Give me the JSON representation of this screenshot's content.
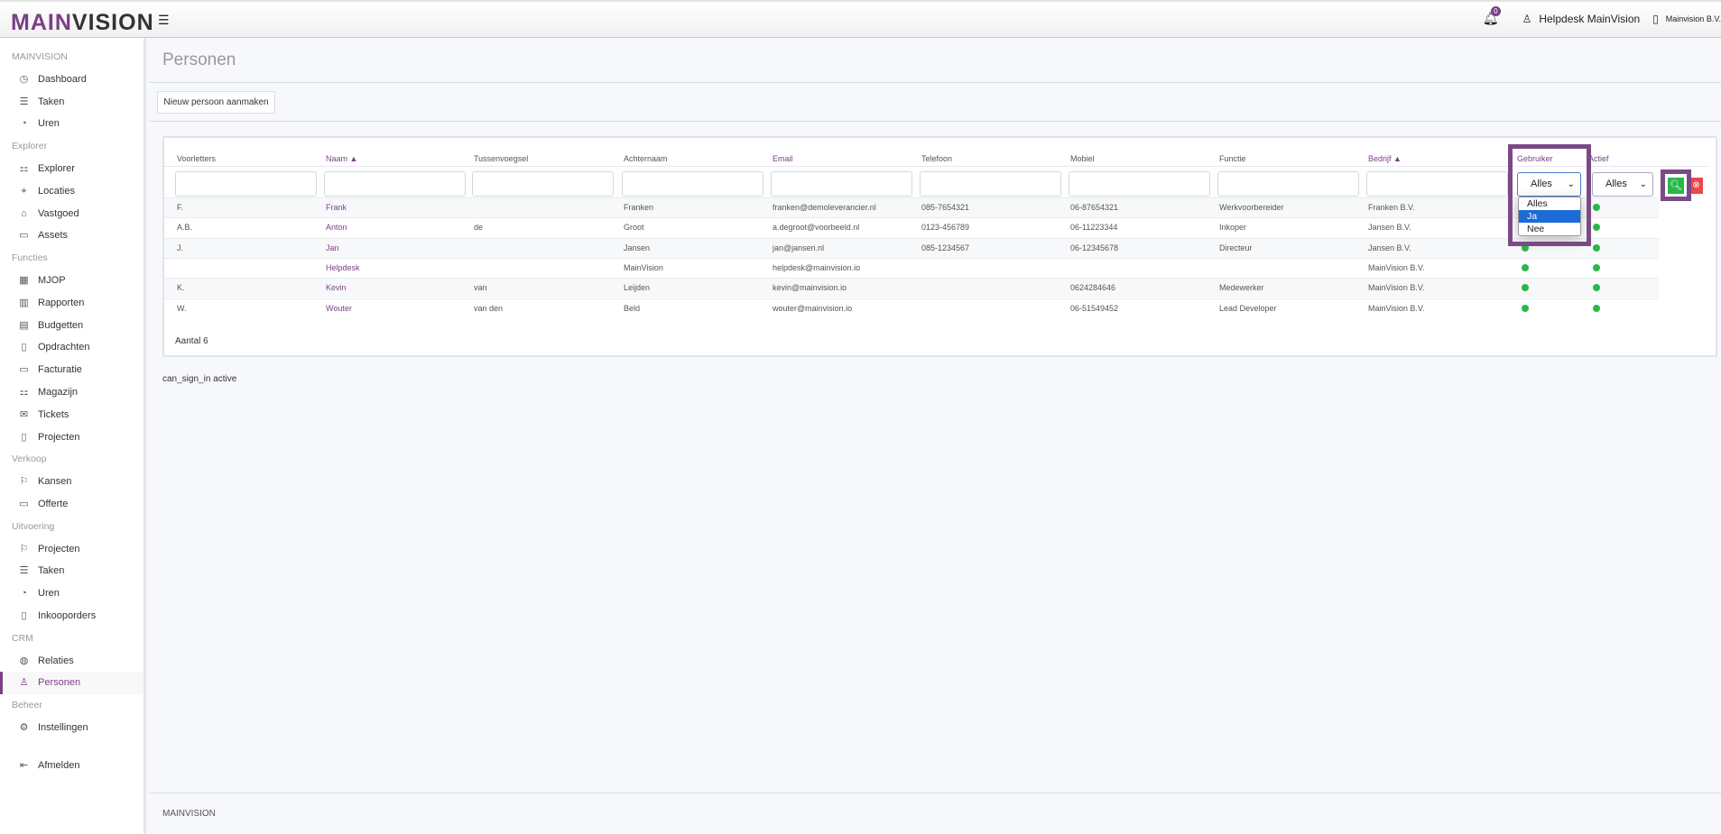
{
  "header": {
    "logo_a": "MAIN",
    "logo_b": "VISION",
    "notifications": "0",
    "user": "Helpdesk MainVision",
    "company": "Mainvision B.V."
  },
  "sidebar": [
    {
      "type": "section",
      "label": "MAINVISION"
    },
    {
      "type": "item",
      "label": "Dashboard",
      "icon": "◷"
    },
    {
      "type": "item",
      "label": "Taken",
      "icon": "☰"
    },
    {
      "type": "item",
      "label": "Uren",
      "icon": "◔"
    },
    {
      "type": "section",
      "label": "Explorer"
    },
    {
      "type": "item",
      "label": "Explorer",
      "icon": "⚏"
    },
    {
      "type": "item",
      "label": "Locaties",
      "icon": "⌖"
    },
    {
      "type": "item",
      "label": "Vastgoed",
      "icon": "⌂"
    },
    {
      "type": "item",
      "label": "Assets",
      "icon": "▭"
    },
    {
      "type": "section",
      "label": "Functies"
    },
    {
      "type": "item",
      "label": "MJOP",
      "icon": "▦"
    },
    {
      "type": "item",
      "label": "Rapporten",
      "icon": "▥"
    },
    {
      "type": "item",
      "label": "Budgetten",
      "icon": "▤"
    },
    {
      "type": "item",
      "label": "Opdrachten",
      "icon": "▯"
    },
    {
      "type": "item",
      "label": "Facturatie",
      "icon": "▭"
    },
    {
      "type": "item",
      "label": "Magazijn",
      "icon": "⚏"
    },
    {
      "type": "item",
      "label": "Tickets",
      "icon": "✉"
    },
    {
      "type": "item",
      "label": "Projecten",
      "icon": "▯"
    },
    {
      "type": "section",
      "label": "Verkoop"
    },
    {
      "type": "item",
      "label": "Kansen",
      "icon": "⚐"
    },
    {
      "type": "item",
      "label": "Offerte",
      "icon": "▭"
    },
    {
      "type": "section",
      "label": "Uitvoering"
    },
    {
      "type": "item",
      "label": "Projecten",
      "icon": "⚐"
    },
    {
      "type": "item",
      "label": "Taken",
      "icon": "☰"
    },
    {
      "type": "item",
      "label": "Uren",
      "icon": "◔"
    },
    {
      "type": "item",
      "label": "Inkooporders",
      "icon": "▯"
    },
    {
      "type": "section",
      "label": "CRM"
    },
    {
      "type": "item",
      "label": "Relaties",
      "icon": "◍"
    },
    {
      "type": "item",
      "label": "Personen",
      "icon": "♙",
      "active": true
    },
    {
      "type": "section",
      "label": "Beheer"
    },
    {
      "type": "item",
      "label": "Instellingen",
      "icon": "⚙"
    },
    {
      "type": "gap"
    },
    {
      "type": "item",
      "label": "Afmelden",
      "icon": "⇤"
    }
  ],
  "page": {
    "title": "Personen",
    "new_button": "Nieuw persoon aanmaken",
    "count": "Aantal 6",
    "note": "can_sign_in active",
    "footer": "MAINVISION"
  },
  "table": {
    "columns": [
      {
        "label": "Voorletters",
        "sorted": false
      },
      {
        "label": "Naam ▲",
        "sorted": true
      },
      {
        "label": "Tussenvoegsel",
        "sorted": false
      },
      {
        "label": "Achternaam",
        "sorted": false
      },
      {
        "label": "Email",
        "sorted": true
      },
      {
        "label": "Telefoon",
        "sorted": false
      },
      {
        "label": "Mobiel",
        "sorted": false
      },
      {
        "label": "Functie",
        "sorted": false
      },
      {
        "label": "Bedrijf ▲",
        "sorted": true
      },
      {
        "label": "Gebruiker",
        "sorted": true
      },
      {
        "label": "Actief",
        "sorted": true
      }
    ],
    "filters": {
      "gebruiker": "Alles",
      "actief": "Alles",
      "gebruiker_options": [
        "Alles",
        "Ja",
        "Nee"
      ],
      "highlighted_option": "Ja"
    },
    "rows": [
      [
        "F.",
        "Frank",
        "",
        "Franken",
        "franken@demoleverancier.nl",
        "085-7654321",
        "06-87654321",
        "Werkvoorbereider",
        "Franken B.V.",
        true,
        true
      ],
      [
        "A.B.",
        "Anton",
        "de",
        "Groot",
        "a.degroot@voorbeeld.nl",
        "0123-456789",
        "06-11223344",
        "Inkoper",
        "Jansen B.V.",
        true,
        true
      ],
      [
        "J.",
        "Jan",
        "",
        "Jansen",
        "jan@jansen.nl",
        "085-1234567",
        "06-12345678",
        "Directeur",
        "Jansen B.V.",
        true,
        true
      ],
      [
        "",
        "Helpdesk",
        "",
        "MainVision",
        "helpdesk@mainvision.io",
        "",
        "",
        "",
        "MainVision B.V.",
        true,
        true
      ],
      [
        "K.",
        "Kevin",
        "van",
        "Leijden",
        "kevin@mainvision.io",
        "",
        "0624284646",
        "Medewerker",
        "MainVision B.V.",
        true,
        true
      ],
      [
        "W.",
        "Wouter",
        "van den",
        "Beld",
        "wouter@mainvision.io",
        "",
        "06-51549452",
        "Lead Developer",
        "MainVision B.V.",
        true,
        true
      ]
    ]
  },
  "colors": {
    "brand": "#7b3f86",
    "active_dot": "#28b848",
    "search": "#28b848",
    "clear": "#e8484f",
    "highlight": "#1c6bd6"
  }
}
